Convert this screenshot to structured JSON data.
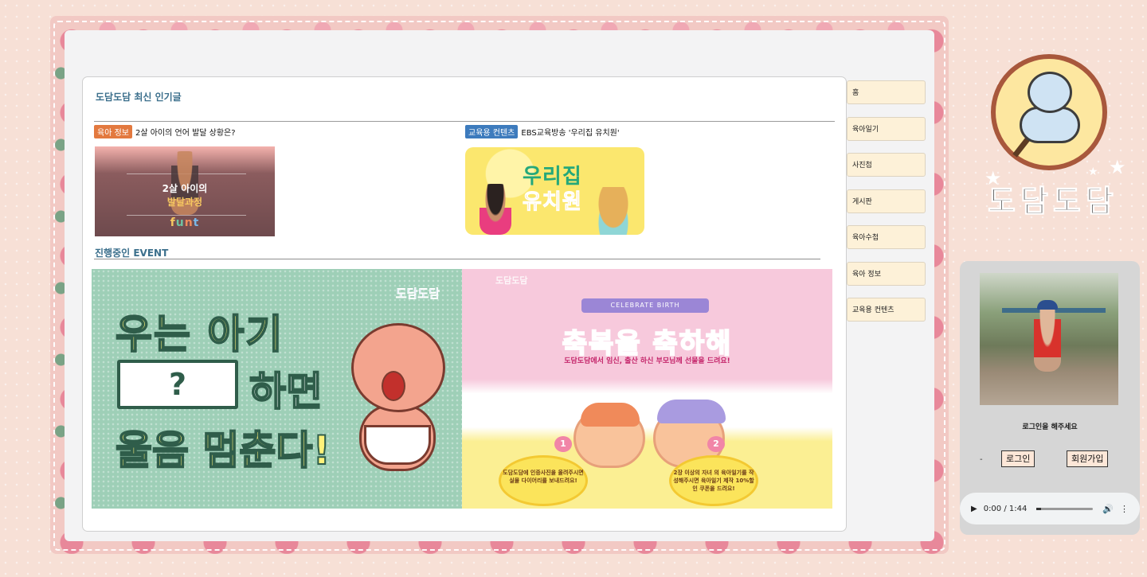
{
  "panel": {
    "title": "도담도담 최신 인기글",
    "posts": [
      {
        "category": "육아 정보",
        "title": "2살 아이의 언어 발달 상황은?",
        "thumb_line1": "2살 아이의",
        "thumb_line2": "발달과정",
        "thumb_line3": "funt"
      },
      {
        "category": "교육용 컨텐츠",
        "title": "EBS교육방송 '우리집 유치원'",
        "thumb_line1": "우리집",
        "thumb_line2": "유치원"
      }
    ],
    "event_title": "진행중인 EVENT"
  },
  "banner_left": {
    "logo": "도담도담",
    "line1": "우는 아기",
    "box": "?",
    "line2": "하면",
    "line3": "울음 멈춘다!"
  },
  "banner_right": {
    "logo": "도담도담",
    "ribbon": "CELEBRATE BIRTH",
    "title": "축복을 축하해",
    "subtitle": "도담도담에서 임신, 출산 하신 부모님께 선물을 드려요!",
    "step1_num": "1",
    "step1_text": "도담도담에 인증사진을 올려주시면 실물 다이어리를 보내드려요!",
    "step2_num": "2",
    "step2_text": "2장 이상의 자녀 의 육아일기를 작성해주시면 육아일기 제작 10%할인 쿠폰을 드려요!"
  },
  "nav": {
    "items": [
      "홈",
      "육아일기",
      "사진첩",
      "게시판",
      "육아수첩",
      "육아 정보",
      "교육용 컨텐츠"
    ]
  },
  "logo": {
    "text": "도담도담"
  },
  "sidebar": {
    "login_message": "로그인을 해주세요",
    "dash": "-",
    "login_button": "로그인",
    "signup_button": "회원가입"
  },
  "audio": {
    "time": "0:00 / 1:44"
  },
  "colors": {
    "background": "#f7e0d6",
    "accent_title": "#3b6f8c",
    "badge_orange": "#e3793f",
    "badge_blue": "#3d7bbd",
    "nav_bg": "#fdf1d8"
  }
}
